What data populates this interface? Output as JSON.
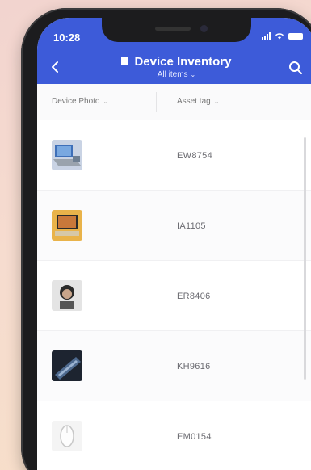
{
  "status_bar": {
    "time": "10:28"
  },
  "header": {
    "title": "Device Inventory",
    "subtitle": "All items",
    "accent_color": "#3d5bd9",
    "back_icon": "chevron-left-icon",
    "search_icon": "search-icon"
  },
  "columns": {
    "photo": "Device Photo",
    "tag": "Asset tag"
  },
  "rows": [
    {
      "asset_tag": "EW8754",
      "thumb": "laptop-blue"
    },
    {
      "asset_tag": "IA1105",
      "thumb": "tablet-gold"
    },
    {
      "asset_tag": "ER8406",
      "thumb": "headphones"
    },
    {
      "asset_tag": "KH9616",
      "thumb": "keyboard-dark"
    },
    {
      "asset_tag": "EM0154",
      "thumb": "mouse-white"
    }
  ]
}
